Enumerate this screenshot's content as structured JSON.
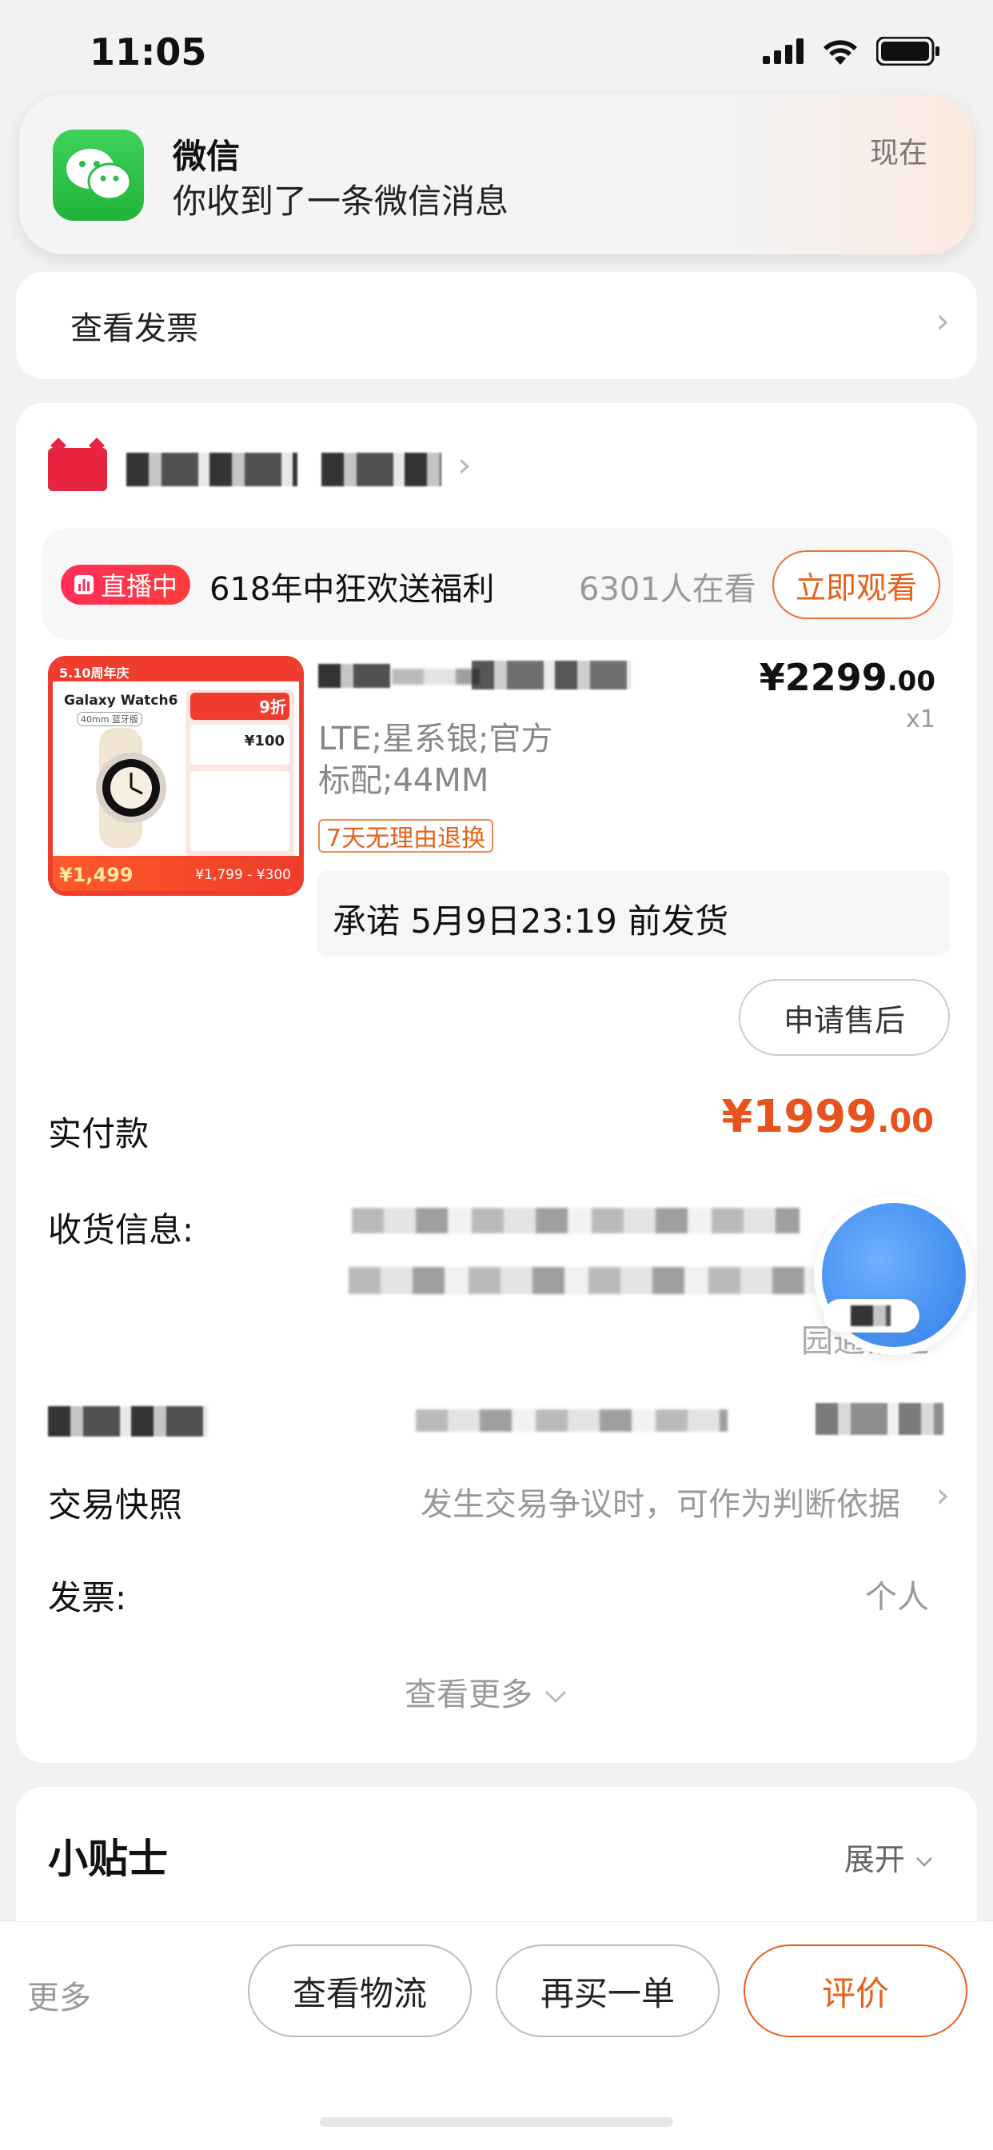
{
  "status_bar": {
    "time": "11:05"
  },
  "notification": {
    "app_name": "微信",
    "message": "你收到了一条微信消息",
    "time": "现在"
  },
  "invoice_row": {
    "label": "查看发票"
  },
  "live": {
    "badge": "直播中",
    "title": "618年中狂欢送福利",
    "viewers": "6301人在看",
    "watch_button": "立即观看"
  },
  "product": {
    "sku_line1": "LTE;星系银;官方",
    "sku_line2": "标配;44MM",
    "price_main": "¥2299",
    "price_decimal": ".00",
    "quantity": "x1",
    "return_policy": "7天无理由退换",
    "ship_promise": "承诺 5月9日23:19 前发货",
    "image_texts": {
      "badge": "5.10周年庆",
      "model": "Galaxy Watch6",
      "size": "40mm 蓝牙版",
      "discount": "9折",
      "promo": "¥100",
      "price_tag": "¥1,499",
      "orig_price": "¥1,799 - ¥300"
    }
  },
  "actions": {
    "aftersale": "申请售后"
  },
  "payment": {
    "label": "实付款",
    "amount_main": "¥1999",
    "amount_decimal": ".00"
  },
  "shipping": {
    "label": "收货信息:",
    "courier_suffix": "园通易递"
  },
  "snapshot": {
    "label": "交易快照",
    "hint": "发生交易争议时，可作为判断依据"
  },
  "invoice": {
    "label": "发票:",
    "value": "个人"
  },
  "see_more": "查看更多",
  "tips": {
    "title": "小贴士",
    "expand": "展开"
  },
  "bottom_bar": {
    "more": "更多",
    "logistics": "查看物流",
    "rebuy": "再买一单",
    "rate": "评价"
  },
  "colors": {
    "accent_orange": "#e8601a",
    "price_red": "#e8521c",
    "live_pink": "#ff2d5a",
    "wechat_green": "#20b33a"
  }
}
